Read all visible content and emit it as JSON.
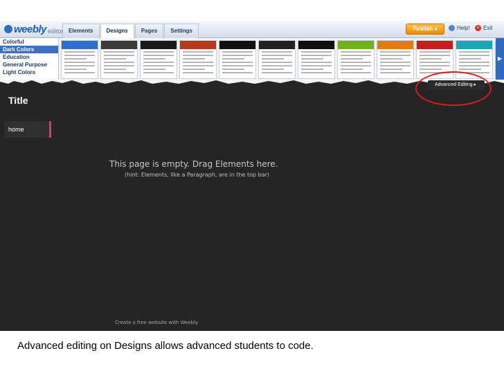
{
  "app": {
    "brand": "weebly",
    "brand_sub": "editor"
  },
  "toolbar": {
    "tabs": [
      "Elements",
      "Designs",
      "Pages",
      "Settings"
    ],
    "active_tab": "Designs",
    "publish_label": "Publish »",
    "help_label": "Help!",
    "exit_label": "Exit"
  },
  "design_categories": {
    "items": [
      "Colorful",
      "Dark Colors",
      "Education",
      "General Purpose",
      "Light Colors"
    ],
    "selected": "Dark Colors"
  },
  "theme_thumbnails": {
    "header_colors": [
      "#2d6fc9",
      "#3b3b3b",
      "#1a1a1a",
      "#b33a1a",
      "#101010",
      "#222222",
      "#0f0f0f",
      "#6fb11f",
      "#e07b16",
      "#c41f1f",
      "#1fa4b5",
      "#e0c21f",
      "#3a3a3a",
      "#5a7a2a"
    ],
    "selected_index": 12
  },
  "page": {
    "title": "Title",
    "nav_home": "home",
    "empty_message": "This page is empty. Drag Elements here.",
    "empty_hint": "(hint: Elements, like a Paragraph, are in the top bar)",
    "footer_link": "Create a free website with Weebly"
  },
  "advanced_editing": {
    "label": "Advanced Editing ▸"
  },
  "caption": "Advanced editing on Designs allows advanced students to code.",
  "colors": {
    "highlight": "#d81f1f",
    "nav_accent": "#d13e70",
    "selected_category": "#3a6fc4",
    "page_background": "#252525"
  }
}
